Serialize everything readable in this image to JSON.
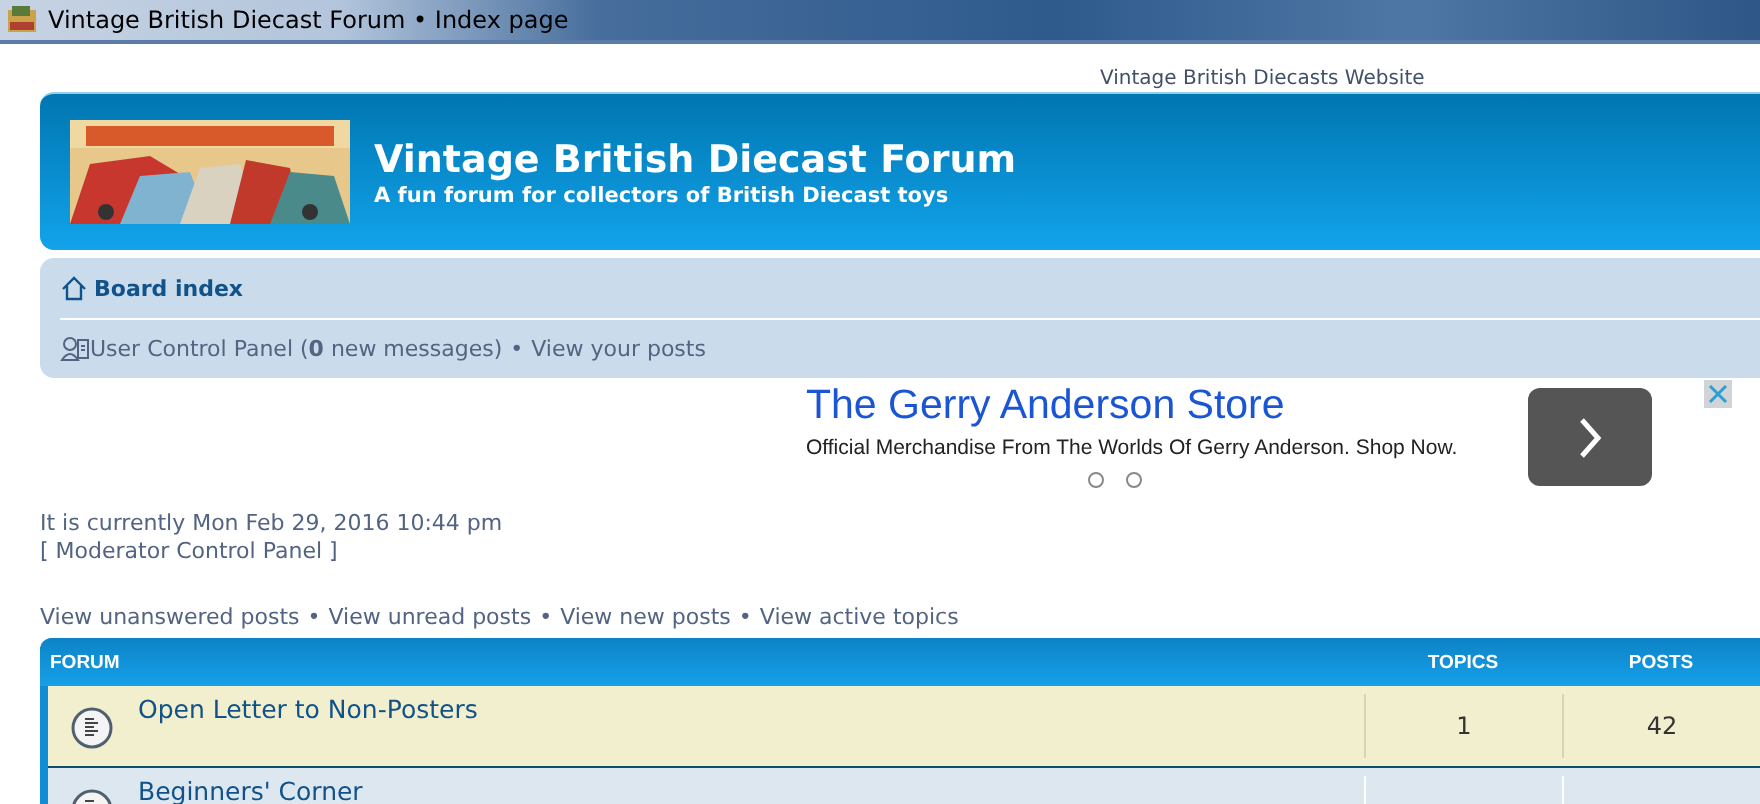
{
  "window": {
    "title": "Vintage British Diecast Forum • Index page"
  },
  "top_link": "Vintage British Diecasts Website",
  "header": {
    "title": "Vintage British Diecast Forum",
    "subtitle": "A fun forum for collectors of British Diecast toys"
  },
  "navbar": {
    "breadcrumb": "Board index",
    "user_links": [
      {
        "label": "User Control Panel (**0** new messages)",
        "separator": "•"
      },
      {
        "label": "View your posts"
      }
    ]
  },
  "ad": {
    "title": "The Gerry Anderson Store",
    "text": "Official Merchandise From The Worlds Of Gerry Anderson. Shop Now.",
    "pages": [
      {
        "selected": false
      },
      {
        "selected": false
      }
    ]
  },
  "status": {
    "time": "It is currently Mon Feb 29, 2016 10:44 pm",
    "moderator_link": "[ Moderator Control Panel ]"
  },
  "search_links": [
    {
      "label": "View unanswered posts",
      "separator": "•"
    },
    {
      "label": "View unread posts",
      "separator": "•"
    },
    {
      "label": "View new posts",
      "separator": "•"
    },
    {
      "label": "View active topics"
    }
  ],
  "table": {
    "columns": [
      "FORUM",
      "TOPICS",
      "POSTS"
    ],
    "rows": [
      {
        "title": "Open Letter to Non-Posters",
        "topics": "1",
        "posts": "42"
      },
      {
        "title": "Beginners' Corner"
      }
    ]
  }
}
